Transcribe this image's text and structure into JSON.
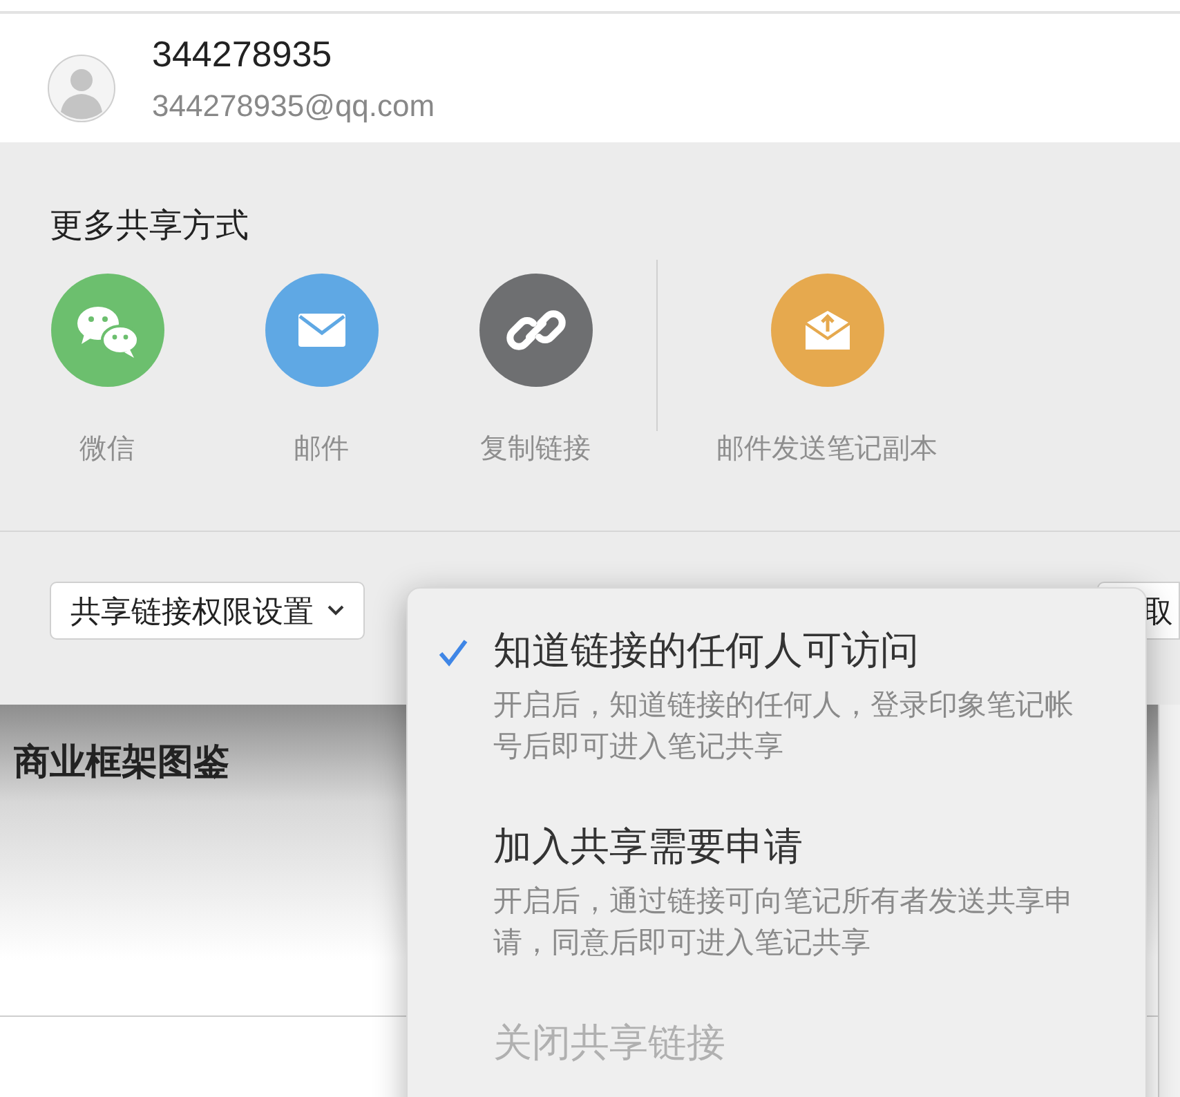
{
  "contact": {
    "name": "344278935",
    "email": "344278935@qq.com"
  },
  "share_panel": {
    "heading": "更多共享方式",
    "methods": [
      {
        "kind": "wechat",
        "label": "微信"
      },
      {
        "kind": "mail",
        "label": "邮件"
      },
      {
        "kind": "link",
        "label": "复制链接"
      }
    ],
    "extra": [
      {
        "kind": "send",
        "label": "邮件发送笔记副本"
      }
    ],
    "permission_button": {
      "label": "共享链接权限设置"
    },
    "cancel_button": {
      "label": "取"
    }
  },
  "note": {
    "title": "商业框架图鉴"
  },
  "permission_menu": [
    {
      "title": "知道链接的任何人可访问",
      "description": "开启后，知道链接的任何人，登录印象笔记帐号后即可进入笔记共享",
      "selected": true,
      "disabled": false
    },
    {
      "title": "加入共享需要申请",
      "description": "开启后，通过链接可向笔记所有者发送共享申请，同意后即可进入笔记共享",
      "selected": false,
      "disabled": false
    },
    {
      "title": "关闭共享链接",
      "selected": false,
      "disabled": true
    }
  ]
}
